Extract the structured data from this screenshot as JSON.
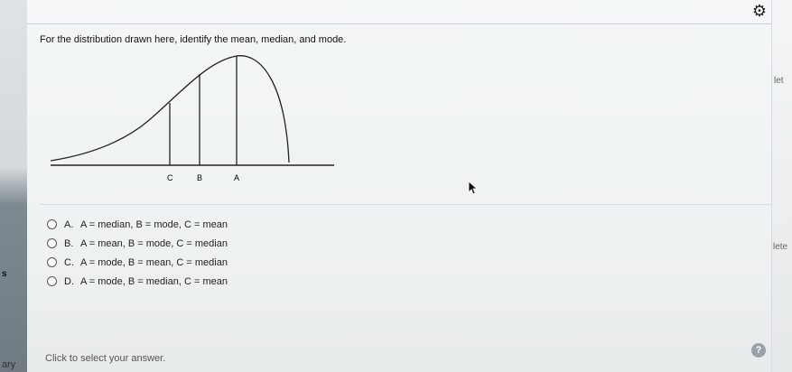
{
  "question": {
    "text": "For the distribution drawn here, identify the mean, median, and mode."
  },
  "graph": {
    "labels": [
      "C",
      "B",
      "A"
    ]
  },
  "options": [
    {
      "letter": "A.",
      "text": "A = median, B = mode, C = mean"
    },
    {
      "letter": "B.",
      "text": "A = mean, B = mode, C = median"
    },
    {
      "letter": "C.",
      "text": "A = mode, B = mean, C = median"
    },
    {
      "letter": "D.",
      "text": "A = mode, B = median, C = mean"
    }
  ],
  "status": {
    "text": "Click to select your answer."
  },
  "left_edge": {
    "label": "ary",
    "mark": "s"
  },
  "right_edge": {
    "fragments": [
      "let",
      "lete"
    ]
  },
  "icons": {
    "settings": "gear-icon",
    "help": "help-icon",
    "cursor": "cursor-arrow-icon"
  }
}
